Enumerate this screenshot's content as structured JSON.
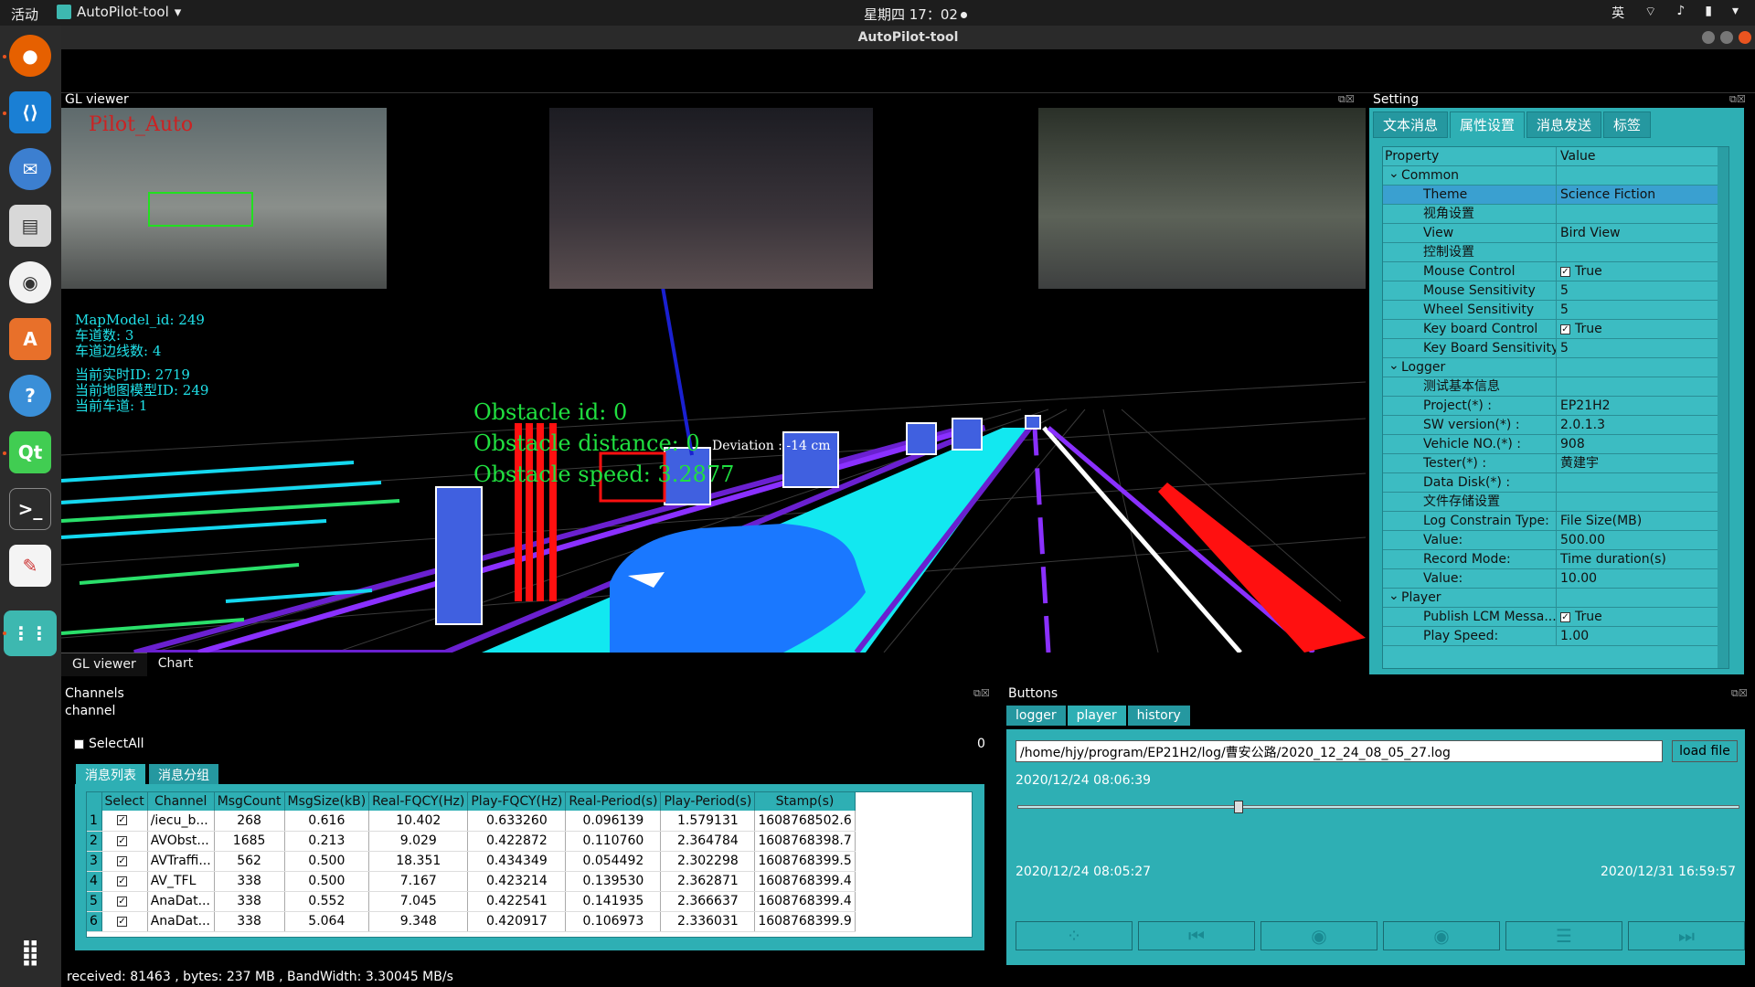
{
  "system": {
    "activities": "活动",
    "app_name": "AutoPilot-tool",
    "clock": "星期四 17：02",
    "input_method": "英"
  },
  "window": {
    "title": "AutoPilot-tool"
  },
  "gl_viewer": {
    "header": "GL viewer",
    "cam_label": "Pilot_Auto",
    "map_info": [
      "MapModel_id: 249",
      "车道数: 3",
      "车道边线数: 4"
    ],
    "realtime_info": [
      "当前实时ID: 2719",
      "当前地图模型ID: 249",
      "当前车道: 1"
    ],
    "obstacle": {
      "id": "Obstacle id: 0",
      "distance": "Obstacle distance: 0",
      "speed": "Obstacle speed: 3.2877"
    },
    "deviation": "Deviation : -14 cm",
    "tabs": [
      "GL viewer",
      "Chart"
    ]
  },
  "setting": {
    "header": "Setting",
    "tabs": [
      "文本消息",
      "属性设置",
      "消息发送",
      "标签"
    ],
    "active_tab": 1,
    "columns": {
      "property": "Property",
      "value": "Value"
    },
    "rows": [
      {
        "type": "grp",
        "p": "Common",
        "v": ""
      },
      {
        "type": "sel",
        "p": "Theme",
        "v": "Science Fiction"
      },
      {
        "type": "sub",
        "p": "视角设置",
        "v": ""
      },
      {
        "type": "sub",
        "p": "View",
        "v": "Bird View"
      },
      {
        "type": "sub",
        "p": "控制设置",
        "v": ""
      },
      {
        "type": "sub",
        "p": "Mouse Control",
        "v": "True",
        "check": true
      },
      {
        "type": "sub",
        "p": "Mouse Sensitivity",
        "v": "5"
      },
      {
        "type": "sub",
        "p": "Wheel Sensitivity",
        "v": "5"
      },
      {
        "type": "sub",
        "p": "Key board Control",
        "v": "True",
        "check": true
      },
      {
        "type": "sub",
        "p": "Key Board Sensitivity",
        "v": "5"
      },
      {
        "type": "grp",
        "p": "Logger",
        "v": ""
      },
      {
        "type": "sub",
        "p": "测试基本信息",
        "v": ""
      },
      {
        "type": "sub",
        "p": "Project(*) :",
        "v": "EP21H2"
      },
      {
        "type": "sub",
        "p": "SW version(*) :",
        "v": "2.0.1.3"
      },
      {
        "type": "sub",
        "p": "Vehicle NO.(*) :",
        "v": "908"
      },
      {
        "type": "sub",
        "p": "Tester(*) :",
        "v": "黄建宇"
      },
      {
        "type": "sub",
        "p": "Data Disk(*) :",
        "v": ""
      },
      {
        "type": "sub",
        "p": "文件存储设置",
        "v": ""
      },
      {
        "type": "sub",
        "p": "Log Constrain Type:",
        "v": "File Size(MB)"
      },
      {
        "type": "sub",
        "p": "Value:",
        "v": "500.00"
      },
      {
        "type": "sub",
        "p": "Record Mode:",
        "v": "Time duration(s)"
      },
      {
        "type": "sub",
        "p": "Value:",
        "v": "10.00"
      },
      {
        "type": "grp",
        "p": "Player",
        "v": ""
      },
      {
        "type": "sub",
        "p": "Publish LCM Messa...",
        "v": "True",
        "check": true
      },
      {
        "type": "sub",
        "p": "Play Speed:",
        "v": "1.00"
      }
    ]
  },
  "channels": {
    "header": "Channels",
    "subheader": "channel",
    "select_all": "SelectAll",
    "count": "0",
    "tabs": [
      "消息列表",
      "消息分组"
    ],
    "columns": [
      "Select",
      "Channel",
      "MsgCount",
      "MsgSize(kB)",
      "Real-FQCY(Hz)",
      "Play-FQCY(Hz)",
      "Real-Period(s)",
      "Play-Period(s)",
      "Stamp(s)"
    ],
    "rows": [
      [
        "1",
        "/iecu_b...",
        "268",
        "0.616",
        "10.402",
        "0.633260",
        "0.096139",
        "1.579131",
        "1608768502.6"
      ],
      [
        "2",
        "AVObst...",
        "1685",
        "0.213",
        "9.029",
        "0.422872",
        "0.110760",
        "2.364784",
        "1608768398.7"
      ],
      [
        "3",
        "AVTraffi...",
        "562",
        "0.500",
        "18.351",
        "0.434349",
        "0.054492",
        "2.302298",
        "1608768399.5"
      ],
      [
        "4",
        "AV_TFL",
        "338",
        "0.500",
        "7.167",
        "0.423214",
        "0.139530",
        "2.362871",
        "1608768399.4"
      ],
      [
        "5",
        "AnaDat...",
        "338",
        "0.552",
        "7.045",
        "0.422541",
        "0.141935",
        "2.366637",
        "1608768399.4"
      ],
      [
        "6",
        "AnaDat...",
        "338",
        "5.064",
        "9.348",
        "0.420917",
        "0.106973",
        "2.336031",
        "1608768399.9"
      ]
    ]
  },
  "buttons": {
    "header": "Buttons",
    "tabs": [
      "logger",
      "player",
      "history"
    ],
    "active_tab": 1,
    "path": "/home/hjy/program/EP21H2/log/曹安公路/2020_12_24_08_05_27.log",
    "load_file": "load file",
    "current_time": "2020/12/24 08:06:39",
    "start_time": "2020/12/24 08:05:27",
    "end_time": "2020/12/31 16:59:57",
    "progress": 0.3
  },
  "status": {
    "text": "received: 81463 , bytes: 237 MB , BandWidth: 3.30045 MB/s"
  }
}
